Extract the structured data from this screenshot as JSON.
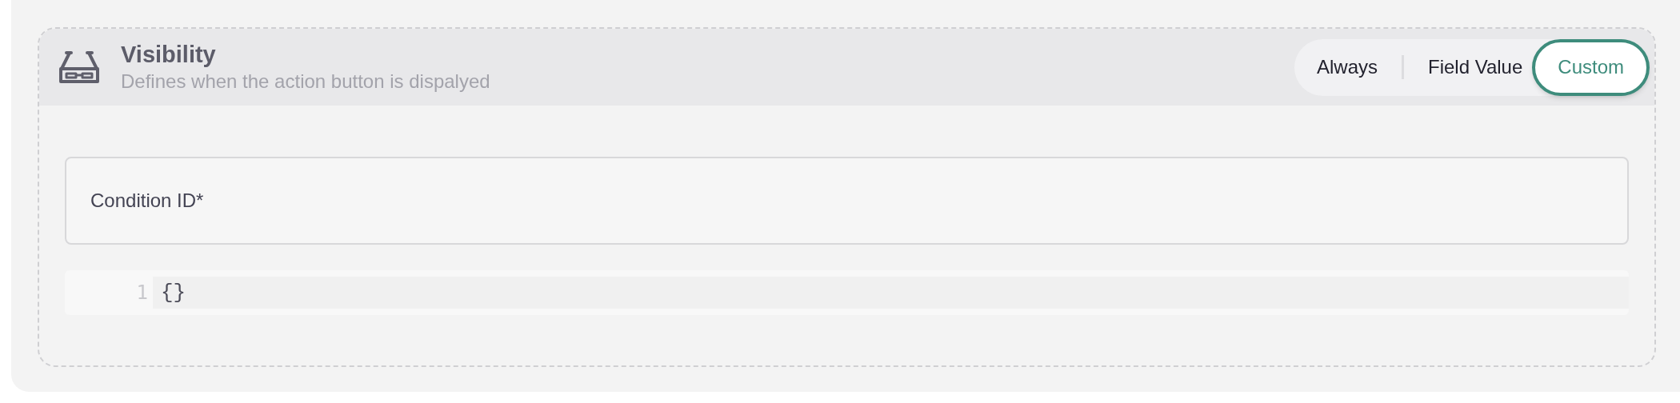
{
  "section": {
    "title": "Visibility",
    "subtitle": "Defines when the action button is dispalyed"
  },
  "modes": [
    {
      "label": "Always",
      "selected": false
    },
    {
      "label": "Field Value",
      "selected": false
    },
    {
      "label": "Custom",
      "selected": true
    }
  ],
  "field": {
    "label": "Condition ID*"
  },
  "editor": {
    "lines": [
      {
        "number": "1",
        "code": "{}"
      }
    ]
  }
}
